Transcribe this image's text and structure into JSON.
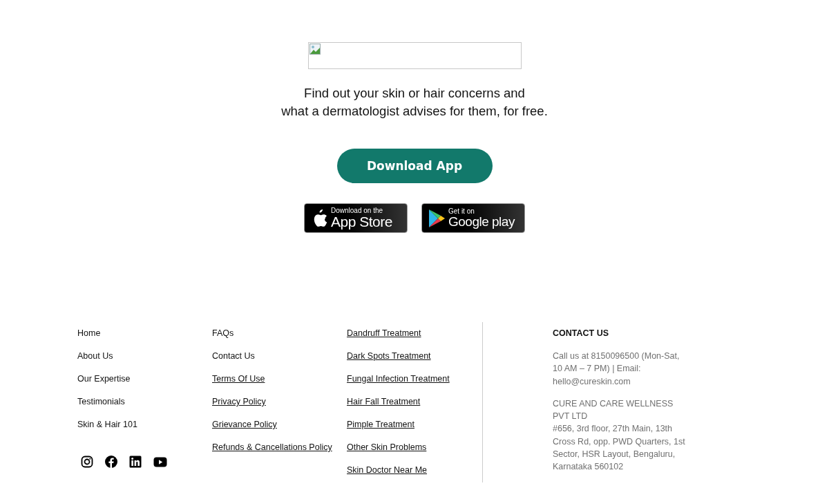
{
  "hero": {
    "tagline_lines": [
      "Find out your skin or hair concerns and",
      "what a dermatologist advises for them, for free."
    ],
    "download_button": "Download App",
    "store_badges": [
      {
        "kind": "apple",
        "small": "Download on the",
        "big": "App Store"
      },
      {
        "kind": "google",
        "small": "Get it on",
        "big": "Google play"
      }
    ]
  },
  "footer": {
    "columns": [
      {
        "links": [
          {
            "label": "Home",
            "underlined": false
          },
          {
            "label": "About Us",
            "underlined": false
          },
          {
            "label": "Our Expertise",
            "underlined": false
          },
          {
            "label": "Testimonials",
            "underlined": false
          },
          {
            "label": "Skin & Hair 101",
            "underlined": false
          }
        ]
      },
      {
        "links": [
          {
            "label": "FAQs",
            "underlined": false
          },
          {
            "label": "Contact Us",
            "underlined": false
          },
          {
            "label": "Terms Of Use",
            "underlined": true
          },
          {
            "label": "Privacy Policy",
            "underlined": true
          },
          {
            "label": "Grievance Policy",
            "underlined": true
          },
          {
            "label": "Refunds & Cancellations Policy",
            "underlined": true
          }
        ]
      },
      {
        "links": [
          {
            "label": "Dandruff Treatment",
            "underlined": true
          },
          {
            "label": "Dark Spots Treatment",
            "underlined": true
          },
          {
            "label": "Fungal Infection Treatment",
            "underlined": true
          },
          {
            "label": "Hair Fall Treatment",
            "underlined": true
          },
          {
            "label": "Pimple Treatment",
            "underlined": true
          },
          {
            "label": "Other Skin Problems",
            "underlined": true
          },
          {
            "label": "Skin Doctor Near Me",
            "underlined": true
          }
        ]
      }
    ],
    "social": [
      {
        "kind": "instagram"
      },
      {
        "kind": "facebook"
      },
      {
        "kind": "linkedin"
      },
      {
        "kind": "youtube"
      }
    ],
    "contact": {
      "heading": "CONTACT US",
      "phone_email": "Call us at 8150096500 (Mon-Sat, 10 AM – 7 PM) | Email: hello@cureskin.com",
      "company": "CURE AND CARE WELLNESS PVT LTD",
      "address": "#656, 3rd floor, 27th Main, 13th Cross Rd, opp. PWD Quarters, 1st Sector, HSR Layout, Bengaluru, Karnataka 560102"
    }
  }
}
